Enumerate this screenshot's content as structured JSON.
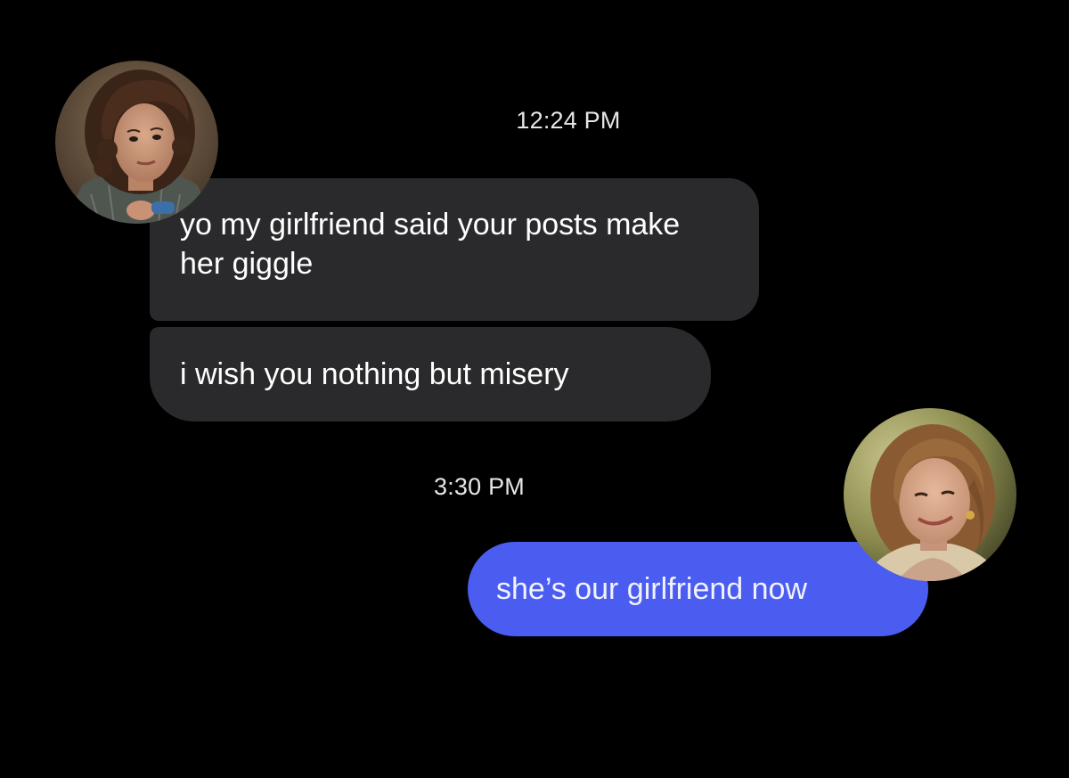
{
  "conversation": {
    "groups": [
      {
        "timestamp": "12:24 PM",
        "messages": [
          {
            "sender": "other",
            "text": "yo my girlfriend said your posts make her giggle"
          },
          {
            "sender": "other",
            "text": "i wish you nothing but misery"
          }
        ]
      },
      {
        "timestamp": "3:30 PM",
        "messages": [
          {
            "sender": "self",
            "text": "she’s our girlfriend now"
          }
        ]
      }
    ]
  },
  "avatars": {
    "left": {
      "icon": "profile-photo-woman-curly-hair"
    },
    "right": {
      "icon": "profile-photo-woman-smiling"
    }
  },
  "colors": {
    "background": "#000000",
    "incoming_bubble": "#2a2a2c",
    "outgoing_bubble": "#4a5df0",
    "text": "#ffffff",
    "timestamp": "#e6e6e6"
  }
}
